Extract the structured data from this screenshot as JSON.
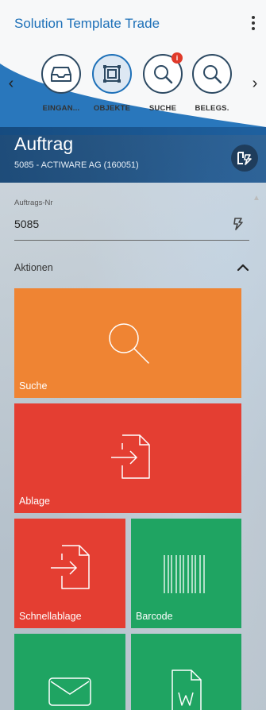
{
  "header": {
    "app_title": "Solution Template Trade",
    "nav_items": [
      {
        "label": "EINGAN...",
        "icon": "inbox-icon"
      },
      {
        "label": "OBJEKTE",
        "icon": "objects-icon",
        "active": true
      },
      {
        "label": "SUCHE",
        "icon": "search-icon",
        "badge": "i"
      },
      {
        "label": "BELEGS.",
        "icon": "search-icon"
      }
    ]
  },
  "title_bar": {
    "title": "Auftrag",
    "subtitle": "5085 - ACTIWARE AG (160051)"
  },
  "form": {
    "order_field": {
      "label": "Auftrags-Nr",
      "value": "5085"
    },
    "section_label": "Aktionen"
  },
  "tiles": [
    {
      "label": "Suche",
      "color": "#ef8433",
      "icon": "search-icon"
    },
    {
      "label": "Ablage",
      "color": "#e43e32",
      "icon": "file-import-icon"
    },
    {
      "label": "Schnellablage",
      "color": "#e43e32",
      "icon": "file-import-icon"
    },
    {
      "label": "Barcode",
      "color": "#1fa462",
      "icon": "barcode-icon"
    },
    {
      "label": "",
      "color": "#1fa462",
      "icon": "mail-icon"
    },
    {
      "label": "",
      "color": "#1fa462",
      "icon": "word-document-icon"
    }
  ],
  "colors": {
    "accent": "#1d70b8",
    "header_bg": "#f7f8f9"
  }
}
